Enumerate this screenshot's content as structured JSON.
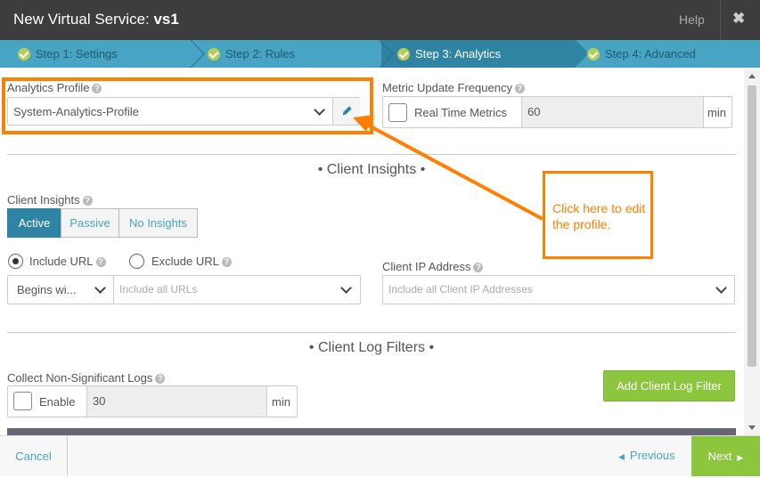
{
  "window": {
    "title_prefix": "New Virtual Service: ",
    "title_name": "vs1",
    "help_label": "Help",
    "close_glyph": "✖"
  },
  "steps": [
    {
      "label": "Step 1: Settings",
      "state": "done"
    },
    {
      "label": "Step 2: Rules",
      "state": "done"
    },
    {
      "label": "Step 3: Analytics",
      "state": "active"
    },
    {
      "label": "Step 4: Advanced",
      "state": "done"
    }
  ],
  "analytics": {
    "profile_label": "Analytics Profile",
    "profile_value": "System-Analytics-Profile",
    "metric_label": "Metric Update Frequency",
    "realtime_label": "Real Time Metrics",
    "metric_value": "60",
    "metric_unit": "min"
  },
  "client_insights": {
    "section_title": "• Client Insights •",
    "label": "Client Insights",
    "options": [
      "Active",
      "Passive",
      "No Insights"
    ],
    "selected": "Active",
    "include_url_label": "Include URL",
    "exclude_url_label": "Exclude URL",
    "url_match_value": "Begins wi...",
    "url_placeholder": "Include all URLs",
    "client_ip_label": "Client IP Address",
    "client_ip_placeholder": "Include all Client IP Addresses"
  },
  "client_logs": {
    "section_title": "• Client Log Filters •",
    "collect_label": "Collect Non-Significant Logs",
    "enable_label": "Enable",
    "value": "30",
    "unit": "min",
    "add_button": "Add Client Log Filter"
  },
  "footer": {
    "cancel": "Cancel",
    "previous": "Previous",
    "next": "Next"
  },
  "annotation": {
    "callout_text": "Click here to edit the profile.",
    "color": "#ff7f00"
  },
  "colors": {
    "accent": "#48a4c3",
    "active_step": "#2f83a3",
    "green": "#8cc63f",
    "title_bar": "#3d3d3d"
  }
}
